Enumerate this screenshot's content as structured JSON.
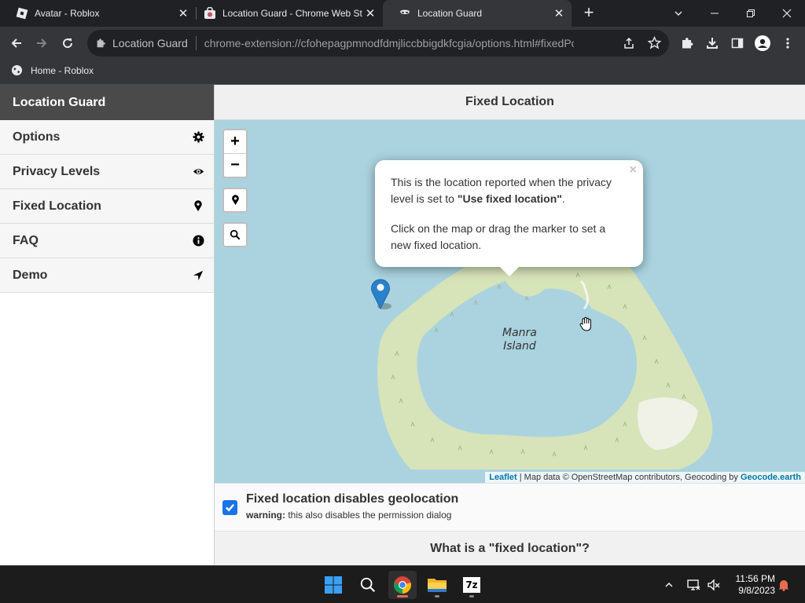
{
  "browser": {
    "tabs": [
      {
        "title": "Avatar - Roblox",
        "active": false
      },
      {
        "title": "Location Guard - Chrome Web St",
        "active": false
      },
      {
        "title": "Location Guard",
        "active": true
      }
    ],
    "new_tab_label": "+",
    "close_glyph": "✕",
    "omnibox": {
      "site_name": "Location Guard",
      "url": "chrome-extension://cfohepagpmnodfdmjliccbbigdkfcgia/options.html#fixedPos"
    },
    "bookmarks": [
      {
        "label": "Home - Roblox",
        "icon": "globe-icon"
      }
    ]
  },
  "sidebar": {
    "title": "Location Guard",
    "items": [
      {
        "label": "Options",
        "icon": "gear-icon"
      },
      {
        "label": "Privacy Levels",
        "icon": "eye-icon"
      },
      {
        "label": "Fixed Location",
        "icon": "map-marker-icon"
      },
      {
        "label": "FAQ",
        "icon": "info-icon"
      },
      {
        "label": "Demo",
        "icon": "location-arrow-icon"
      }
    ]
  },
  "main": {
    "title": "Fixed Location",
    "map": {
      "zoom_in_label": "+",
      "zoom_out_label": "−",
      "popup": {
        "close_label": "×",
        "line1_pre": "This is the location reported when the privacy level is set to ",
        "line1_bold": "\"Use fixed location\"",
        "line1_post": ".",
        "line2": "Click on the map or drag the marker to set a new fixed location."
      },
      "island_label_1": "Manra",
      "island_label_2": "Island",
      "attribution": {
        "leaflet": "Leaflet",
        "middle": " | Map data © OpenStreetMap contributors, Geocoding by ",
        "geocode": "Geocode.earth"
      },
      "colors": {
        "water": "#aad3df",
        "land": "#d7e3b9",
        "marker": "#2a81cb"
      }
    },
    "setting": {
      "checked": true,
      "title": "Fixed location disables geolocation",
      "warning_label": "warning:",
      "warning_text": " this also disables the permission dialog"
    },
    "faq_heading": "What is a \"fixed location\"?"
  },
  "taskbar": {
    "apps": [
      "windows-start-icon",
      "search-icon",
      "chrome-icon",
      "file-explorer-icon",
      "7zip-icon"
    ],
    "seven_zip_label": "7z",
    "time": "11:56 PM",
    "date": "9/8/2023"
  }
}
